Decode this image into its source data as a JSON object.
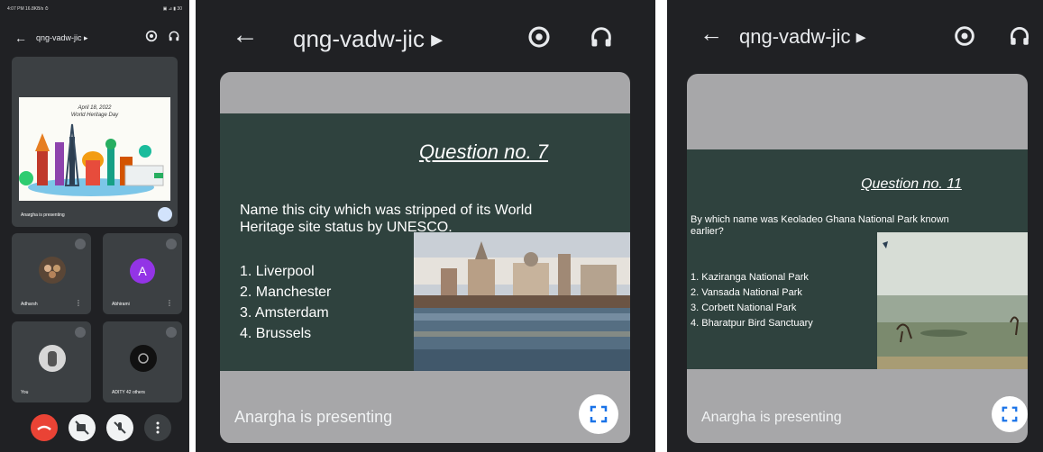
{
  "screen1": {
    "status": {
      "left": "4:07 PM 16.8KB/s ⏱",
      "right": "▣ ⊿ ▮ 30"
    },
    "meeting_code": "qng-vadw-jic ▸",
    "slide_date": "April 18, 2022",
    "slide_title": "World Heritage Day",
    "presenting": "Anargha is presenting",
    "tiles": [
      {
        "name": "Adharsh"
      },
      {
        "name": "Abhirami",
        "initial": "A"
      },
      {
        "name": "You"
      },
      {
        "name": "ADITY 42 others"
      }
    ]
  },
  "screen2": {
    "meeting_code": "qng-vadw-jic ▸",
    "question_title": "Question no. 7",
    "question": "Name this city which was stripped of its World Heritage site status by UNESCO.",
    "options": [
      "1.  Liverpool",
      "2.  Manchester",
      "3.  Amsterdam",
      "4.  Brussels"
    ],
    "presenting": "Anargha is presenting"
  },
  "screen3": {
    "meeting_code": "qng-vadw-jic ▸",
    "question_title": "Question no. 11",
    "question": "By which name was Keoladeo Ghana National Park known earlier?",
    "options": [
      "1.  Kaziranga National Park",
      "2.  Vansada National Park",
      "3.  Corbett National Park",
      "4.  Bharatpur Bird Sanctuary"
    ],
    "presenting": "Anargha is presenting"
  },
  "colors": {
    "background": "#202124",
    "end_call": "#ea4335",
    "slide": "#2f423e",
    "card": "#a7a7a9"
  }
}
